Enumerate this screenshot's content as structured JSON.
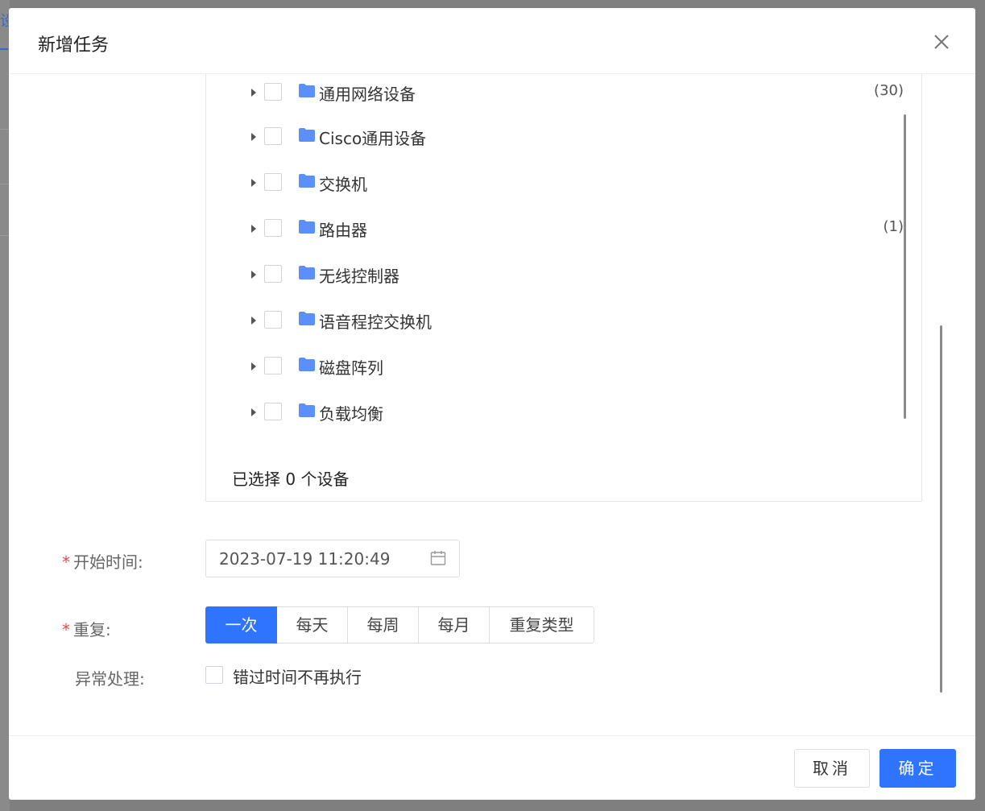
{
  "backdrop": {
    "tab_fragment": "设"
  },
  "modal": {
    "title": "新增任务",
    "close_icon": "close-icon"
  },
  "tree": {
    "partial_top_label": "通用网络设备",
    "partial_top_count": "(30)",
    "items": [
      {
        "label": "Cisco通用设备",
        "count": ""
      },
      {
        "label": "交换机",
        "count": ""
      },
      {
        "label": "路由器",
        "count": "(1)"
      },
      {
        "label": "无线控制器",
        "count": ""
      },
      {
        "label": "语音程控交换机",
        "count": ""
      },
      {
        "label": "磁盘阵列",
        "count": ""
      },
      {
        "label": "负载均衡",
        "count": ""
      }
    ],
    "selected_summary": "已选择 0 个设备",
    "folder_color": "#5b8ff9"
  },
  "form": {
    "start_time_label": "开始时间:",
    "start_time_value": "2023-07-19 11:20:49",
    "repeat_label": "重复:",
    "repeat_options": [
      "一次",
      "每天",
      "每周",
      "每月",
      "重复类型"
    ],
    "repeat_selected": "一次",
    "exception_label": "异常处理:",
    "exception_option": "错过时间不再执行",
    "required_mark": "*"
  },
  "footer": {
    "cancel_label": "取消",
    "ok_label": "确定"
  },
  "colors": {
    "primary": "#2f74ff",
    "required": "#e5484d"
  }
}
